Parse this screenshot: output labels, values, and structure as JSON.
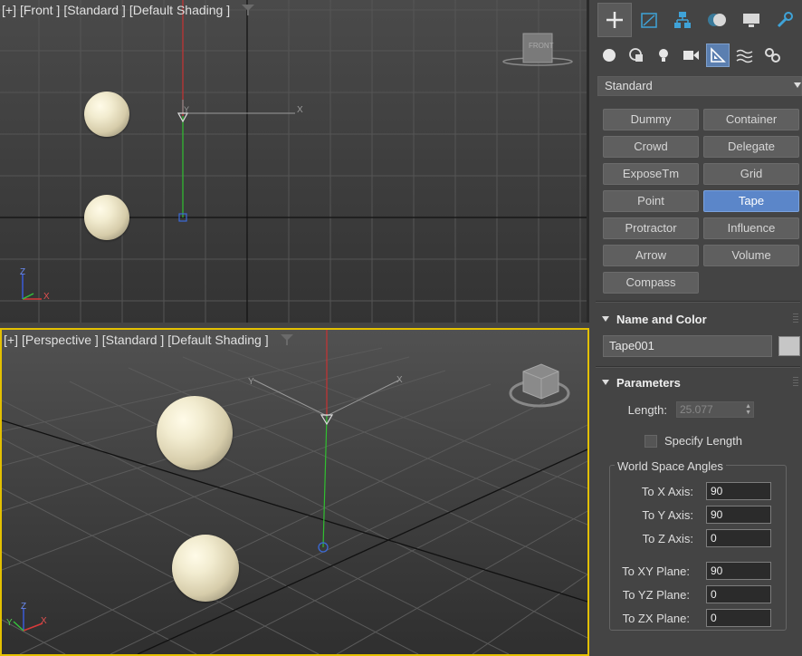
{
  "front_viewport": {
    "labels": [
      "[+]",
      "[Front ]",
      "[Standard ]",
      "[Default Shading ]"
    ],
    "viewcube_face": "FRONT",
    "gizmo_axes": {
      "up": "Z",
      "right": "X"
    },
    "grid_axes": {
      "x": "X",
      "y": "Y"
    }
  },
  "perspective_viewport": {
    "labels": [
      "[+]",
      "[Perspective ]",
      "[Standard ]",
      "[Default Shading ]"
    ],
    "gizmo_axes": {
      "up": "Z",
      "left": "Y",
      "right": "X"
    },
    "grid_axes": {
      "x": "X",
      "y": "Y"
    }
  },
  "command_panel": {
    "tabs": [
      {
        "icon": "create-icon",
        "active": true
      },
      {
        "icon": "modify-icon",
        "active": false
      },
      {
        "icon": "hierarchy-icon",
        "active": false
      },
      {
        "icon": "motion-icon",
        "active": false
      },
      {
        "icon": "display-icon",
        "active": false
      },
      {
        "icon": "utilities-icon",
        "active": false
      }
    ],
    "categories": [
      {
        "icon": "geometry-icon",
        "active": false
      },
      {
        "icon": "shapes-icon",
        "active": false
      },
      {
        "icon": "lights-icon",
        "active": false
      },
      {
        "icon": "cameras-icon",
        "active": false
      },
      {
        "icon": "helpers-icon",
        "active": true
      },
      {
        "icon": "space-warps-icon",
        "active": false
      },
      {
        "icon": "systems-icon",
        "active": false
      }
    ],
    "dropdown": "Standard",
    "object_types": [
      "Dummy",
      "Container",
      "Crowd",
      "Delegate",
      "ExposeTm",
      "Grid",
      "Point",
      "Tape",
      "Protractor",
      "Influence",
      "Arrow",
      "Volume",
      "Compass"
    ],
    "active_object_type": "Tape",
    "name_and_color": {
      "title": "Name and Color",
      "name": "Tape001",
      "color": "#c6c6c6"
    },
    "parameters": {
      "title": "Parameters",
      "length_label": "Length:",
      "length_value": "25.077",
      "specify_length_label": "Specify Length",
      "specify_length_checked": false,
      "group_title": "World Space Angles",
      "angles": [
        {
          "label": "To X Axis:",
          "value": "90"
        },
        {
          "label": "To Y Axis:",
          "value": "90"
        },
        {
          "label": "To Z Axis:",
          "value": "0"
        },
        {
          "label": "To XY Plane:",
          "value": "90"
        },
        {
          "label": "To YZ Plane:",
          "value": "0"
        },
        {
          "label": "To ZX Plane:",
          "value": "0"
        }
      ]
    }
  },
  "colors": {
    "active_viewport_border": "#e3c000",
    "active_button": "#5b86c9",
    "x_axis": "#d83a3a",
    "y_axis": "#35c23c",
    "z_axis": "#3a5bd8"
  }
}
